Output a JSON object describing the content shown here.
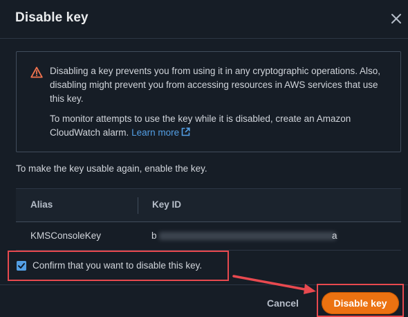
{
  "dialog": {
    "title": "Disable key"
  },
  "alert": {
    "line1": "Disabling a key prevents you from using it in any cryptographic operations. Also, disabling might prevent you from accessing resources in AWS services that use this key.",
    "line2_prefix": "To monitor attempts to use the key while it is disabled, create an Amazon CloudWatch alarm.",
    "link_text": "Learn more",
    "icon": "warning-icon"
  },
  "enable_note": "To make the key usable again, enable the key.",
  "table": {
    "headers": [
      "Alias",
      "Key ID"
    ],
    "rows": [
      {
        "alias": "KMSConsoleKey",
        "key_id_start": "b",
        "key_id_end": "a"
      }
    ]
  },
  "confirm": {
    "label": "Confirm that you want to disable this key.",
    "checked": true
  },
  "footer": {
    "cancel_label": "Cancel",
    "disable_label": "Disable key"
  },
  "colors": {
    "background": "#161d26",
    "accent": "#ec7211",
    "link": "#539fe5",
    "highlight": "#e8494f"
  }
}
